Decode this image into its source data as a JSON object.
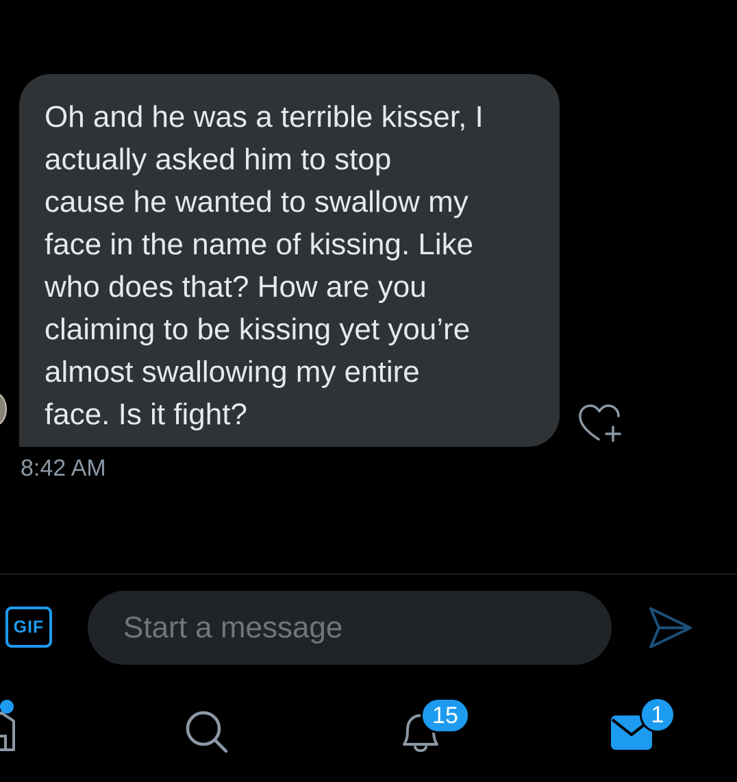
{
  "conversation": {
    "message": {
      "text": "Oh and he was a terrible kisser, I\nactually asked him to stop\ncause he wanted to swallow my\nface in the name of kissing. Like\nwho does that? How are you\nclaiming to be kissing yet you’re\nalmost swallowing my entire\nface. Is it fight?",
      "timestamp": "8:42 AM"
    }
  },
  "composer": {
    "gif_label": "GIF",
    "placeholder": "Start a message",
    "value": ""
  },
  "tab_bar": {
    "notifications_badge": "15",
    "messages_badge": "1"
  },
  "icons": {
    "react": "heart-plus-icon",
    "send": "paper-plane-icon",
    "home": "home-icon",
    "search": "magnifier-icon",
    "notifications": "bell-icon",
    "messages": "envelope-icon"
  },
  "colors": {
    "background": "#000000",
    "bubble": "#2f3336",
    "input": "#202327",
    "accent": "#1d9bf0",
    "muted_text": "#8b98a5",
    "icon_gray": "#8b98a5"
  }
}
